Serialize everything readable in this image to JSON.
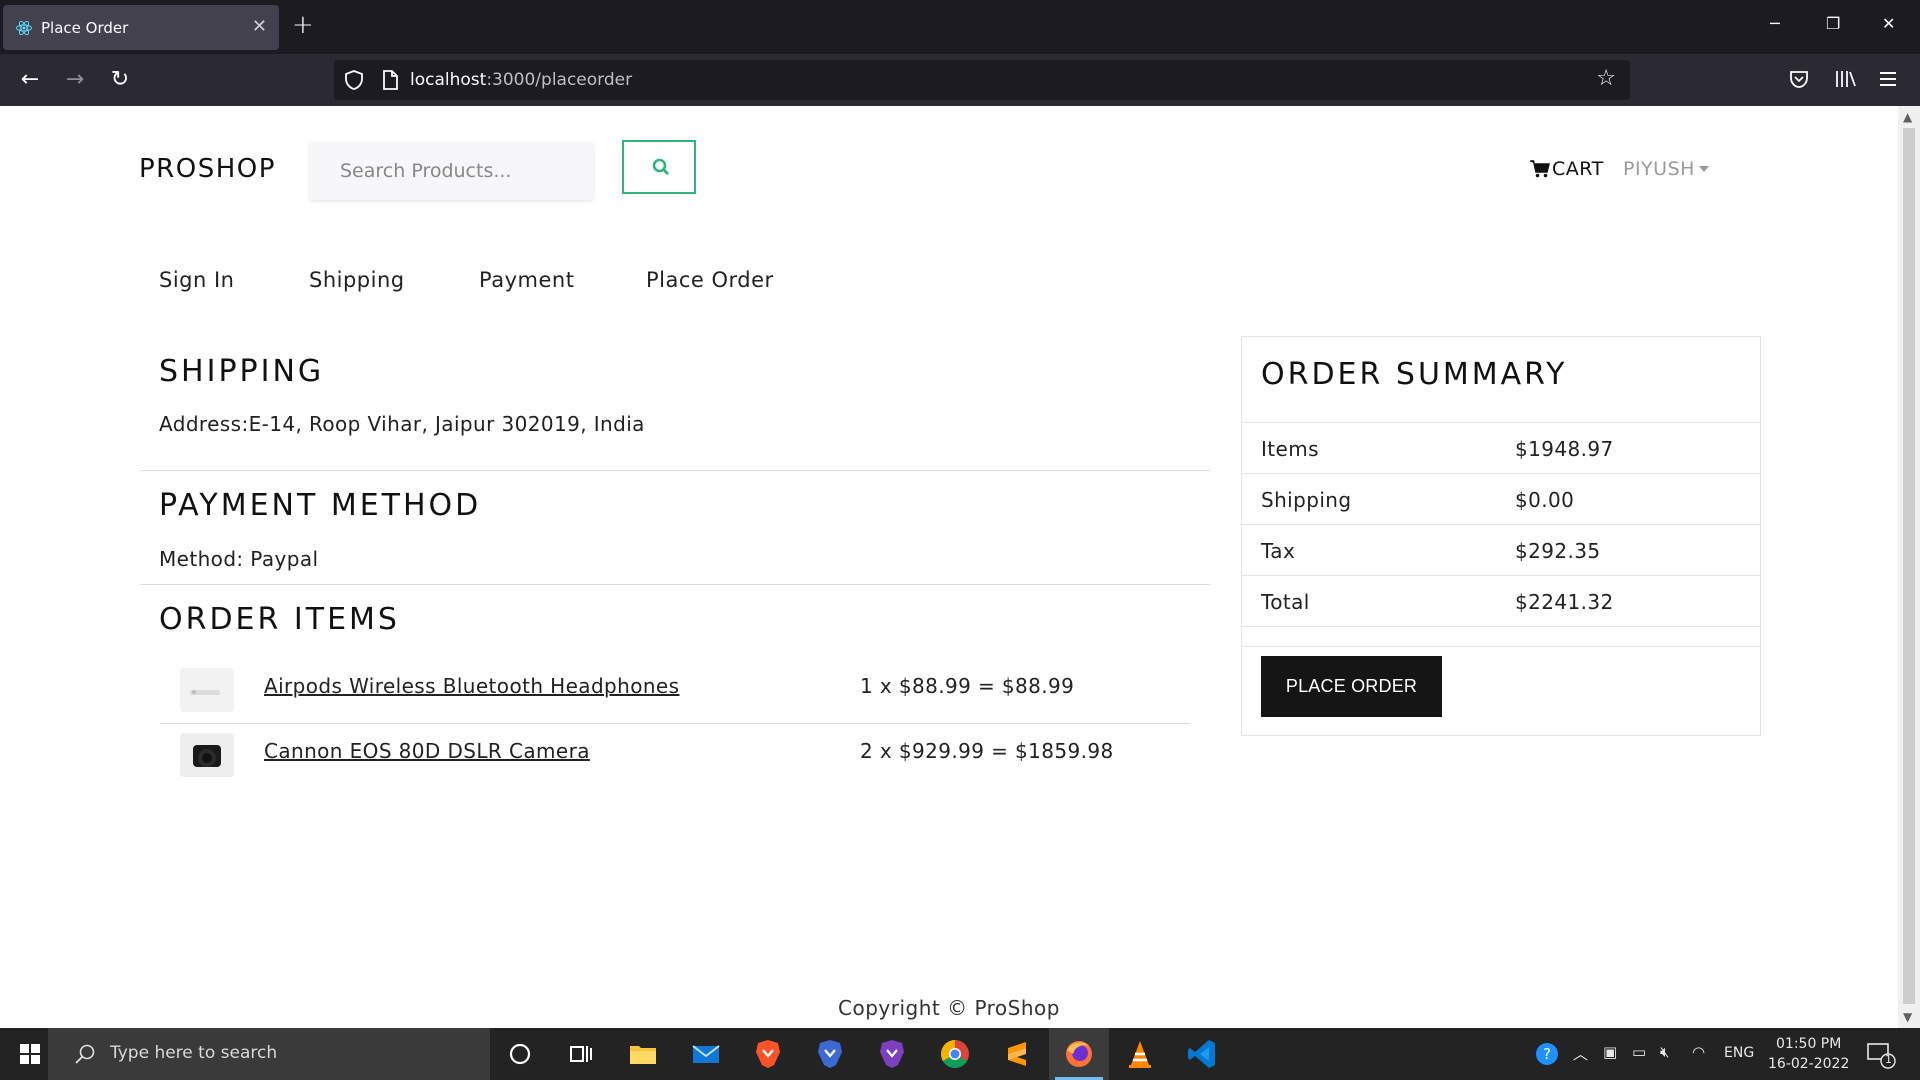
{
  "browser": {
    "tab_title": "Place Order",
    "url_host": "localhost",
    "url_rest": ":3000/placeorder"
  },
  "header": {
    "brand": "PROSHOP",
    "search_placeholder": "Search Products...",
    "cart_label": "CART",
    "user_label": "PIYUSH"
  },
  "steps": [
    "Sign In",
    "Shipping",
    "Payment",
    "Place Order"
  ],
  "shipping": {
    "heading": "SHIPPING",
    "address": "Address:E-14, Roop Vihar, Jaipur 302019, India"
  },
  "payment": {
    "heading": "PAYMENT METHOD",
    "method": "Method: Paypal"
  },
  "order_items": {
    "heading": "ORDER ITEMS",
    "items": [
      {
        "name": "Airpods Wireless Bluetooth Headphones",
        "price_line": "1 x $88.99 = $88.99"
      },
      {
        "name": "Cannon EOS 80D DSLR Camera",
        "price_line": "2 x $929.99 = $1859.98"
      }
    ]
  },
  "summary": {
    "heading": "ORDER SUMMARY",
    "rows": [
      {
        "label": "Items",
        "value": "$1948.97"
      },
      {
        "label": "Shipping",
        "value": "$0.00"
      },
      {
        "label": "Tax",
        "value": "$292.35"
      },
      {
        "label": "Total",
        "value": "$2241.32"
      }
    ],
    "button_label": "PLACE ORDER"
  },
  "footer": "Copyright © ProShop",
  "taskbar": {
    "search_placeholder": "Type here to search",
    "language": "ENG",
    "time": "01:50 PM",
    "date": "16-02-2022",
    "notification_count": "1",
    "apps": [
      "cortana-icon",
      "task-view-icon",
      "file-explorer-icon",
      "mail-icon",
      "brave-icon",
      "brave-beta-icon",
      "brave-nightly-icon",
      "chrome-icon",
      "sublime-text-icon",
      "firefox-icon",
      "vlc-icon",
      "vscode-icon"
    ]
  },
  "colors": {
    "accent_green": "#2fb67c",
    "button_dark": "#151515",
    "chrome_dark": "#1c1b22"
  }
}
